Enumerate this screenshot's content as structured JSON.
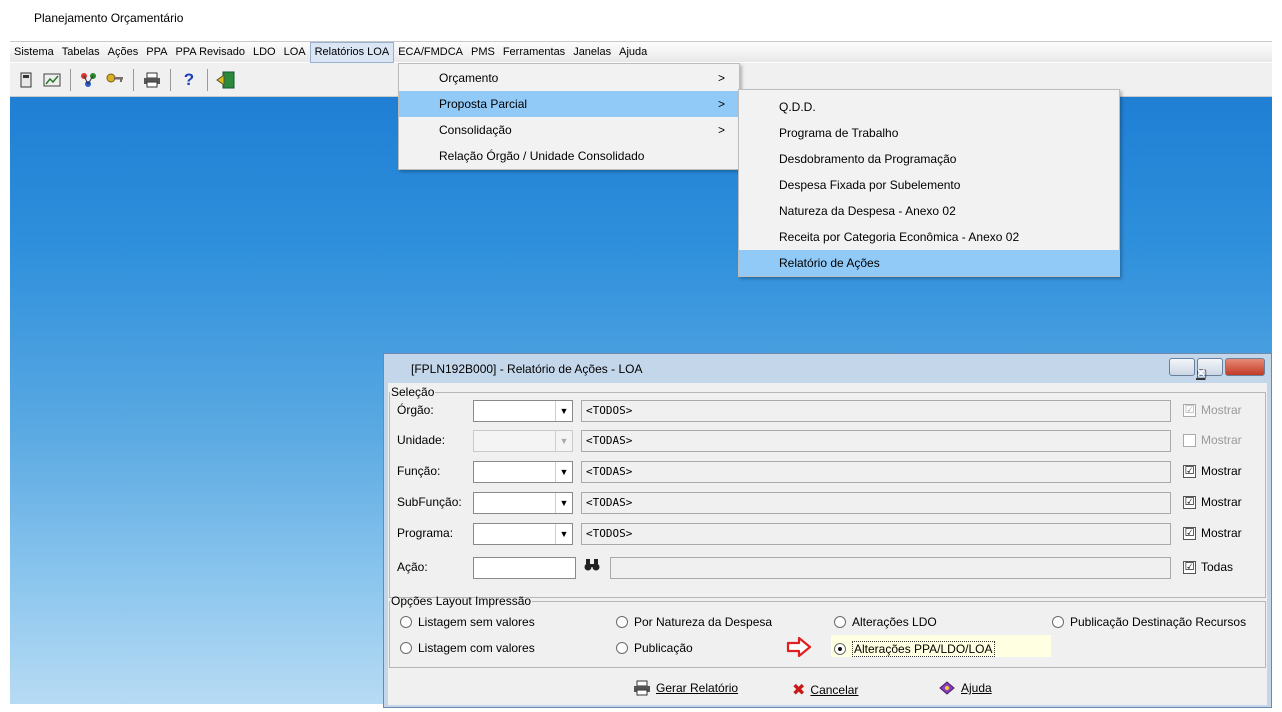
{
  "app": {
    "title": "Planejamento Orçamentário"
  },
  "menubar": {
    "items": [
      "Sistema",
      "Tabelas",
      "Ações",
      "PPA",
      "PPA Revisado",
      "LDO",
      "LOA",
      "Relatórios LOA",
      "ECA/FMDCA",
      "PMS",
      "Ferramentas",
      "Janelas",
      "Ajuda"
    ]
  },
  "menu_relatorios": {
    "items": [
      {
        "label": "Orçamento",
        "arrow": ">"
      },
      {
        "label": "Proposta Parcial",
        "arrow": ">"
      },
      {
        "label": "Consolidação",
        "arrow": ">"
      },
      {
        "label": "Relação Órgão / Unidade Consolidado",
        "arrow": ""
      }
    ]
  },
  "menu_proposta": {
    "items": [
      "Q.D.D.",
      "Programa de Trabalho",
      "Desdobramento da Programação",
      "Despesa Fixada por Subelemento",
      "Natureza da Despesa - Anexo 02",
      "Receita por Categoria Econômica - Anexo 02",
      "Relatório de Ações"
    ]
  },
  "dialog": {
    "title": "[FPLN192B000] - Relatório de Ações - LOA",
    "selecao": {
      "legend": "Seleção",
      "rows": [
        {
          "label": "Órgão:",
          "value": "<TODOS>",
          "check": "Mostrar",
          "checked": "☑"
        },
        {
          "label": "Unidade:",
          "value": "<TODAS>",
          "check": "Mostrar",
          "checked": ""
        },
        {
          "label": "Função:",
          "value": "<TODAS>",
          "check": "Mostrar",
          "checked": "☑"
        },
        {
          "label": "SubFunção:",
          "value": "<TODAS>",
          "check": "Mostrar",
          "checked": "☑"
        },
        {
          "label": "Programa:",
          "value": "<TODOS>",
          "check": "Mostrar",
          "checked": "☑"
        }
      ],
      "acao": {
        "label": "Ação:",
        "check": "Todas"
      }
    },
    "layout": {
      "legend": "Opções Layout Impressão",
      "options": [
        "Listagem sem valores",
        "Por Natureza da Despesa",
        "Alterações LDO",
        "Publicação Destinação Recursos",
        "Listagem com valores",
        "Publicação",
        "Alterações PPA/LDO/LOA"
      ],
      "selected": "Alterações PPA/LDO/LOA"
    },
    "buttons": {
      "gerar": "Gerar Relatório",
      "cancelar": "Cancelar",
      "ajuda": "Ajuda"
    }
  },
  "colors": {
    "menu_highlight": "#91c9f7",
    "desktop_top": "#1f7fd4",
    "desktop_bottom": "#b7dbf4",
    "arrow": "#e02020"
  }
}
